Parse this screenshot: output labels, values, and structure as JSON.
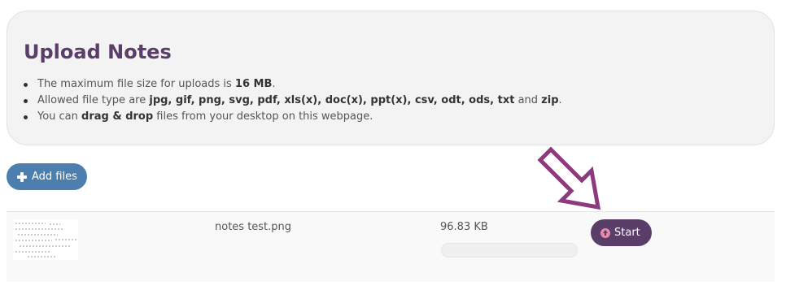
{
  "info": {
    "title": "Upload Notes",
    "rules": [
      {
        "parts": [
          {
            "t": "The maximum file size for uploads is "
          },
          {
            "t": "16 MB",
            "b": true
          },
          {
            "t": "."
          }
        ]
      },
      {
        "parts": [
          {
            "t": "Allowed file type are "
          },
          {
            "t": "jpg, gif, png, svg, pdf, xls(x), doc(x), ppt(x), csv, odt, ods, txt",
            "b": true
          },
          {
            "t": " and "
          },
          {
            "t": "zip",
            "b": true
          },
          {
            "t": "."
          }
        ]
      },
      {
        "parts": [
          {
            "t": "You can "
          },
          {
            "t": "drag & drop",
            "b": true
          },
          {
            "t": " files from your desktop on this webpage."
          }
        ]
      }
    ]
  },
  "toolbar": {
    "add_label": "Add files",
    "add_icon": "plus-icon"
  },
  "annotation": {
    "arrow_color": "#8b3a7d",
    "arrow_icon": "arrow-down-right-icon"
  },
  "file": {
    "name": "notes test.png",
    "size": "96.83 KB",
    "progress": 0,
    "start_label": "Start",
    "start_icon": "upload-circle-icon"
  },
  "colors": {
    "accent": "#5a3d68",
    "add_button": "#4d7fae",
    "icon_pink": "#e98aa8"
  }
}
